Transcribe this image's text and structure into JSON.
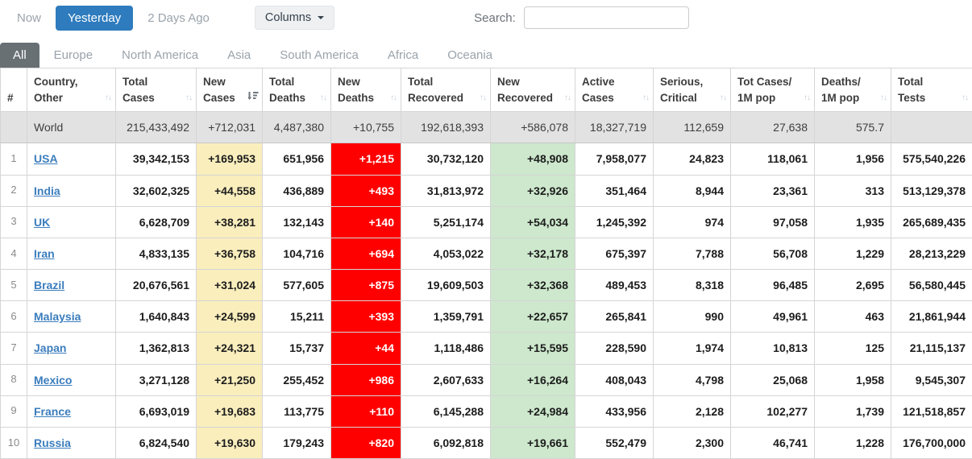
{
  "toolbar": {
    "now_label": "Now",
    "yesterday_label": "Yesterday",
    "two_days_ago_label": "2 Days Ago",
    "columns_label": "Columns",
    "search_label": "Search:",
    "search_value": ""
  },
  "tabs": [
    {
      "label": "All",
      "active": true
    },
    {
      "label": "Europe",
      "active": false
    },
    {
      "label": "North America",
      "active": false
    },
    {
      "label": "Asia",
      "active": false
    },
    {
      "label": "South America",
      "active": false
    },
    {
      "label": "Africa",
      "active": false
    },
    {
      "label": "Oceania",
      "active": false
    }
  ],
  "table": {
    "headers": [
      {
        "line1": "#",
        "line2": "",
        "sortable": false,
        "sort": "none"
      },
      {
        "line1": "Country,",
        "line2": "Other",
        "sortable": true,
        "sort": "none"
      },
      {
        "line1": "Total",
        "line2": "Cases",
        "sortable": true,
        "sort": "none"
      },
      {
        "line1": "New",
        "line2": "Cases",
        "sortable": true,
        "sort": "desc"
      },
      {
        "line1": "Total",
        "line2": "Deaths",
        "sortable": true,
        "sort": "none"
      },
      {
        "line1": "New",
        "line2": "Deaths",
        "sortable": true,
        "sort": "none"
      },
      {
        "line1": "Total",
        "line2": "Recovered",
        "sortable": true,
        "sort": "none"
      },
      {
        "line1": "New",
        "line2": "Recovered",
        "sortable": true,
        "sort": "none"
      },
      {
        "line1": "Active",
        "line2": "Cases",
        "sortable": true,
        "sort": "none"
      },
      {
        "line1": "Serious,",
        "line2": "Critical",
        "sortable": true,
        "sort": "none"
      },
      {
        "line1": "Tot Cases/",
        "line2": "1M pop",
        "sortable": true,
        "sort": "none"
      },
      {
        "line1": "Deaths/",
        "line2": "1M pop",
        "sortable": true,
        "sort": "none"
      },
      {
        "line1": "Total",
        "line2": "Tests",
        "sortable": true,
        "sort": "none"
      }
    ],
    "world_row": {
      "rank": "",
      "country": "World",
      "cells": [
        "215,433,492",
        "+712,031",
        "4,487,380",
        "+10,755",
        "192,618,393",
        "+586,078",
        "18,327,719",
        "112,659",
        "27,638",
        "575.7",
        ""
      ]
    },
    "rows": [
      {
        "rank": "1",
        "country": "USA",
        "cells": [
          "39,342,153",
          "+169,953",
          "651,956",
          "+1,215",
          "30,732,120",
          "+48,908",
          "7,958,077",
          "24,823",
          "118,061",
          "1,956",
          "575,540,226"
        ]
      },
      {
        "rank": "2",
        "country": "India",
        "cells": [
          "32,602,325",
          "+44,558",
          "436,889",
          "+493",
          "31,813,972",
          "+32,926",
          "351,464",
          "8,944",
          "23,361",
          "313",
          "513,129,378"
        ]
      },
      {
        "rank": "3",
        "country": "UK",
        "cells": [
          "6,628,709",
          "+38,281",
          "132,143",
          "+140",
          "5,251,174",
          "+54,034",
          "1,245,392",
          "974",
          "97,058",
          "1,935",
          "265,689,435"
        ]
      },
      {
        "rank": "4",
        "country": "Iran",
        "cells": [
          "4,833,135",
          "+36,758",
          "104,716",
          "+694",
          "4,053,022",
          "+32,178",
          "675,397",
          "7,788",
          "56,708",
          "1,229",
          "28,213,229"
        ]
      },
      {
        "rank": "5",
        "country": "Brazil",
        "cells": [
          "20,676,561",
          "+31,024",
          "577,605",
          "+875",
          "19,609,503",
          "+32,368",
          "489,453",
          "8,318",
          "96,485",
          "2,695",
          "56,580,445"
        ]
      },
      {
        "rank": "6",
        "country": "Malaysia",
        "cells": [
          "1,640,843",
          "+24,599",
          "15,211",
          "+393",
          "1,359,791",
          "+22,657",
          "265,841",
          "990",
          "49,961",
          "463",
          "21,861,944"
        ]
      },
      {
        "rank": "7",
        "country": "Japan",
        "cells": [
          "1,362,813",
          "+24,321",
          "15,737",
          "+44",
          "1,118,486",
          "+15,595",
          "228,590",
          "1,974",
          "10,813",
          "125",
          "21,115,137"
        ]
      },
      {
        "rank": "8",
        "country": "Mexico",
        "cells": [
          "3,271,128",
          "+21,250",
          "255,452",
          "+986",
          "2,607,633",
          "+16,264",
          "408,043",
          "4,798",
          "25,068",
          "1,958",
          "9,545,307"
        ]
      },
      {
        "rank": "9",
        "country": "France",
        "cells": [
          "6,693,019",
          "+19,683",
          "113,775",
          "+110",
          "6,145,288",
          "+24,984",
          "433,956",
          "2,128",
          "102,277",
          "1,739",
          "121,518,857"
        ]
      },
      {
        "rank": "10",
        "country": "Russia",
        "cells": [
          "6,824,540",
          "+19,630",
          "179,243",
          "+820",
          "6,092,818",
          "+19,661",
          "552,479",
          "2,300",
          "46,741",
          "1,228",
          "176,700,000"
        ]
      }
    ]
  },
  "colors": {
    "accent_blue": "#2E7CBE",
    "link_blue": "#3B7DBD",
    "new_cases_yellow": "#FAEEBD",
    "new_deaths_red": "#FF0000",
    "new_recovered_green": "#CDE8CC",
    "world_row_gray": "#E2E2E2",
    "active_tab_gray": "#687074"
  }
}
